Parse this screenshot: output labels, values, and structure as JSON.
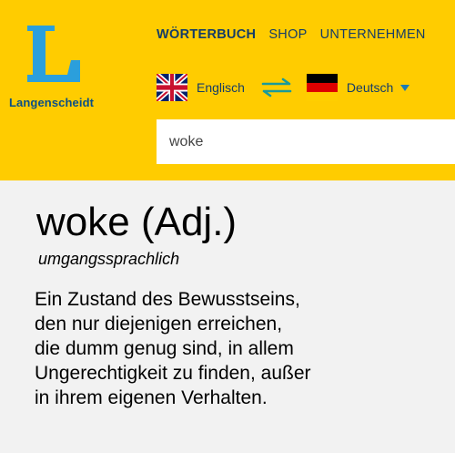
{
  "brand": {
    "logo_letter": "L",
    "name": "Langenscheidt",
    "primary_color": "#ffcc00",
    "logo_color": "#2b9fdc",
    "text_color": "#143c68"
  },
  "nav": {
    "items": [
      "WÖRTERBUCH",
      "SHOP",
      "UNTERNEHMEN"
    ],
    "active": "WÖRTERBUCH"
  },
  "language": {
    "source": {
      "label": "Englisch",
      "icon": "uk-flag-icon"
    },
    "swap_icon": "swap-arrows-icon",
    "target": {
      "label": "Deutsch",
      "icon": "germany-flag-icon"
    },
    "dropdown_icon": "caret-down-icon"
  },
  "search": {
    "value": "woke"
  },
  "entry": {
    "headword": "woke (Adj.)",
    "register": "umgangssprachlich",
    "definition_lines": [
      "Ein Zustand des Bewusstseins,",
      "den nur diejenigen erreichen,",
      "die dumm genug sind, in allem",
      "Ungerechtigkeit zu finden, außer",
      "in ihrem eigenen Verhalten."
    ]
  }
}
